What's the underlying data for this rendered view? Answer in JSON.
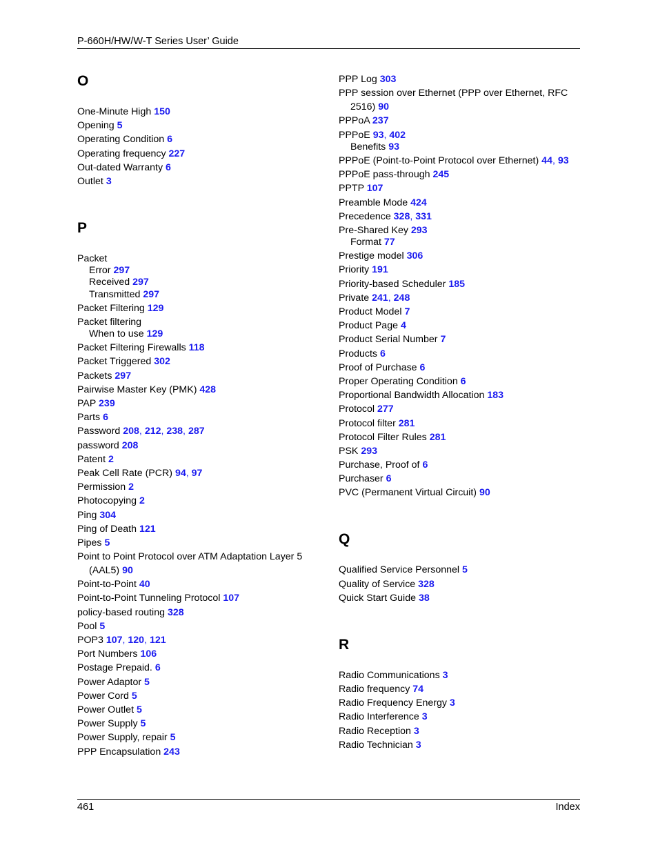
{
  "header": {
    "title": "P-660H/HW/W-T Series User’ Guide"
  },
  "footer": {
    "page_number": "461",
    "section": "Index"
  },
  "link_color": "#1a1af0",
  "columns": [
    {
      "sections": [
        {
          "letter": "O",
          "entries": [
            {
              "text": "One-Minute High",
              "pages": [
                "150"
              ]
            },
            {
              "text": "Opening",
              "pages": [
                "5"
              ]
            },
            {
              "text": "Operating Condition",
              "pages": [
                "6"
              ]
            },
            {
              "text": "Operating frequency",
              "pages": [
                "227"
              ]
            },
            {
              "text": "Out-dated Warranty",
              "pages": [
                "6"
              ]
            },
            {
              "text": "Outlet",
              "pages": [
                "3"
              ]
            }
          ]
        },
        {
          "letter": "P",
          "entries": [
            {
              "text": "Packet",
              "pages": []
            },
            {
              "text": "Error",
              "pages": [
                "297"
              ],
              "sub": true
            },
            {
              "text": "Received",
              "pages": [
                "297"
              ],
              "sub": true
            },
            {
              "text": "Transmitted",
              "pages": [
                "297"
              ],
              "sub": true
            },
            {
              "text": "Packet Filtering",
              "pages": [
                "129"
              ]
            },
            {
              "text": "Packet filtering",
              "pages": []
            },
            {
              "text": "When to use",
              "pages": [
                "129"
              ],
              "sub": true
            },
            {
              "text": "Packet Filtering Firewalls",
              "pages": [
                "118"
              ]
            },
            {
              "text": "Packet Triggered",
              "pages": [
                "302"
              ]
            },
            {
              "text": "Packets",
              "pages": [
                "297"
              ]
            },
            {
              "text": "Pairwise Master Key (PMK)",
              "pages": [
                "428"
              ]
            },
            {
              "text": "PAP",
              "pages": [
                "239"
              ]
            },
            {
              "text": "Parts",
              "pages": [
                "6"
              ]
            },
            {
              "text": "Password",
              "pages": [
                "208",
                "212",
                "238",
                "287"
              ]
            },
            {
              "text": "password",
              "pages": [
                "208"
              ]
            },
            {
              "text": "Patent",
              "pages": [
                "2"
              ]
            },
            {
              "text": "Peak Cell Rate (PCR)",
              "pages": [
                "94",
                "97"
              ]
            },
            {
              "text": "Permission",
              "pages": [
                "2"
              ]
            },
            {
              "text": "Photocopying",
              "pages": [
                "2"
              ]
            },
            {
              "text": "Ping",
              "pages": [
                "304"
              ]
            },
            {
              "text": "Ping of Death",
              "pages": [
                "121"
              ]
            },
            {
              "text": "Pipes",
              "pages": [
                "5"
              ]
            },
            {
              "text": "Point to Point Protocol over ATM Adaptation Layer 5",
              "cont": "(AAL5)",
              "pages": [
                "90"
              ]
            },
            {
              "text": "Point-to-Point",
              "pages": [
                "40"
              ]
            },
            {
              "text": "Point-to-Point Tunneling Protocol",
              "pages": [
                "107"
              ]
            },
            {
              "text": "policy-based routing",
              "pages": [
                "328"
              ]
            },
            {
              "text": "Pool",
              "pages": [
                "5"
              ]
            },
            {
              "text": "POP3",
              "pages": [
                "107",
                "120",
                "121"
              ]
            },
            {
              "text": "Port Numbers",
              "pages": [
                "106"
              ]
            },
            {
              "text": "Postage Prepaid.",
              "pages": [
                "6"
              ]
            },
            {
              "text": "Power Adaptor",
              "pages": [
                "5"
              ]
            },
            {
              "text": "Power Cord",
              "pages": [
                "5"
              ]
            },
            {
              "text": "Power Outlet",
              "pages": [
                "5"
              ]
            },
            {
              "text": "Power Supply",
              "pages": [
                "5"
              ]
            },
            {
              "text": "Power Supply, repair",
              "pages": [
                "5"
              ]
            },
            {
              "text": "PPP Encapsulation",
              "pages": [
                "243"
              ]
            }
          ]
        }
      ]
    },
    {
      "sections": [
        {
          "letter": "",
          "entries": [
            {
              "text": "PPP Log",
              "pages": [
                "303"
              ]
            },
            {
              "text": "PPP session over Ethernet (PPP over Ethernet, RFC",
              "cont": "2516)",
              "pages": [
                "90"
              ]
            },
            {
              "text": "PPPoA",
              "pages": [
                "237"
              ]
            },
            {
              "text": "PPPoE",
              "pages": [
                "93",
                "402"
              ]
            },
            {
              "text": "Benefits",
              "pages": [
                "93"
              ],
              "sub": true
            },
            {
              "text": "PPPoE (Point-to-Point Protocol over Ethernet)",
              "pages": [
                "44",
                "93"
              ]
            },
            {
              "text": "PPPoE pass-through",
              "pages": [
                "245"
              ]
            },
            {
              "text": "PPTP",
              "pages": [
                "107"
              ]
            },
            {
              "text": "Preamble Mode",
              "pages": [
                "424"
              ]
            },
            {
              "text": "Precedence",
              "pages": [
                "328",
                "331"
              ]
            },
            {
              "text": "Pre-Shared Key",
              "pages": [
                "293"
              ]
            },
            {
              "text": "Format",
              "pages": [
                "77"
              ],
              "sub": true
            },
            {
              "text": "Prestige model",
              "pages": [
                "306"
              ]
            },
            {
              "text": "Priority",
              "pages": [
                "191"
              ]
            },
            {
              "text": "Priority-based Scheduler",
              "pages": [
                "185"
              ]
            },
            {
              "text": "Private",
              "pages": [
                "241",
                "248"
              ]
            },
            {
              "text": "Product Model",
              "pages": [
                "7"
              ]
            },
            {
              "text": "Product Page",
              "pages": [
                "4"
              ]
            },
            {
              "text": "Product Serial Number",
              "pages": [
                "7"
              ]
            },
            {
              "text": "Products",
              "pages": [
                "6"
              ]
            },
            {
              "text": "Proof of Purchase",
              "pages": [
                "6"
              ]
            },
            {
              "text": "Proper Operating Condition",
              "pages": [
                "6"
              ]
            },
            {
              "text": "Proportional Bandwidth Allocation",
              "pages": [
                "183"
              ]
            },
            {
              "text": "Protocol",
              "pages": [
                "277"
              ]
            },
            {
              "text": "Protocol filter",
              "pages": [
                "281"
              ]
            },
            {
              "text": "Protocol Filter Rules",
              "pages": [
                "281"
              ]
            },
            {
              "text": "PSK",
              "pages": [
                "293"
              ]
            },
            {
              "text": "Purchase, Proof of",
              "pages": [
                "6"
              ]
            },
            {
              "text": "Purchaser",
              "pages": [
                "6"
              ]
            },
            {
              "text": "PVC (Permanent Virtual Circuit)",
              "pages": [
                "90"
              ]
            }
          ]
        },
        {
          "letter": "Q",
          "entries": [
            {
              "text": "Qualified Service Personnel",
              "pages": [
                "5"
              ]
            },
            {
              "text": "Quality of Service",
              "pages": [
                "328"
              ]
            },
            {
              "text": "Quick Start Guide",
              "pages": [
                "38"
              ]
            }
          ]
        },
        {
          "letter": "R",
          "entries": [
            {
              "text": "Radio Communications",
              "pages": [
                "3"
              ]
            },
            {
              "text": "Radio frequency",
              "pages": [
                "74"
              ]
            },
            {
              "text": "Radio Frequency Energy",
              "pages": [
                "3"
              ]
            },
            {
              "text": "Radio Interference",
              "pages": [
                "3"
              ]
            },
            {
              "text": "Radio Reception",
              "pages": [
                "3"
              ]
            },
            {
              "text": "Radio Technician",
              "pages": [
                "3"
              ]
            }
          ]
        }
      ]
    }
  ]
}
